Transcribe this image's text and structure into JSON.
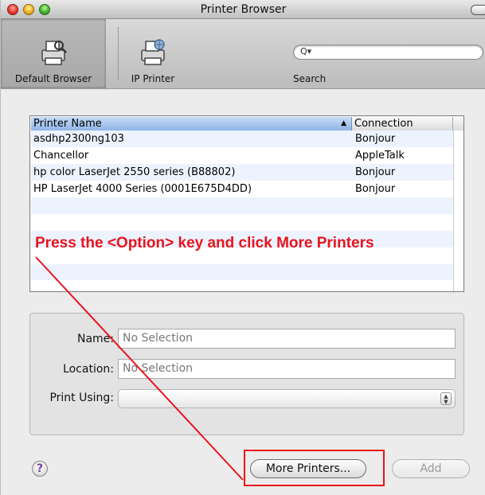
{
  "window": {
    "title": "Printer Browser"
  },
  "toolbar": {
    "items": [
      {
        "label": "Default Browser",
        "icon": "printer-icon",
        "selected": true
      },
      {
        "label": "IP Printer",
        "icon": "network-printer-icon",
        "selected": false
      }
    ],
    "search_label": "Search",
    "search_placeholder": "",
    "search_icon_glyph": "Q▾"
  },
  "table": {
    "columns": {
      "name": "Printer Name",
      "connection": "Connection"
    },
    "sort_indicator": "▲",
    "rows": [
      {
        "name": "asdhp2300ng103",
        "connection": "Bonjour"
      },
      {
        "name": "Chancellor",
        "connection": "AppleTalk"
      },
      {
        "name": "hp color LaserJet 2550 series (B88802)",
        "connection": "Bonjour"
      },
      {
        "name": "HP LaserJet 4000 Series (0001E675D4DD)",
        "connection": "Bonjour"
      }
    ]
  },
  "annotation": {
    "text": "Press the <Option> key and click More Printers",
    "color": "#e8141c"
  },
  "details": {
    "name_label": "Name:",
    "name_value": "No Selection",
    "location_label": "Location:",
    "location_value": "No Selection",
    "print_using_label": "Print Using:",
    "print_using_value": ""
  },
  "buttons": {
    "help": "?",
    "more_printers": "More Printers...",
    "add": "Add"
  }
}
